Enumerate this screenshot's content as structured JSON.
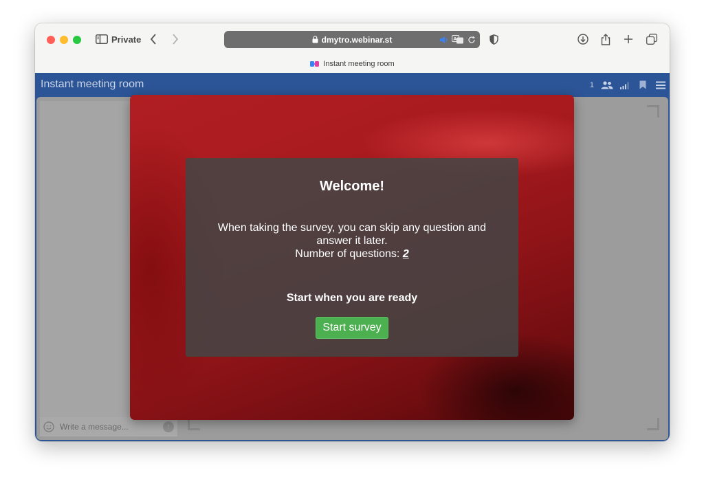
{
  "browser": {
    "private_label": "Private",
    "url": "dmytro.webinar.st",
    "tab_title": "Instant meeting room"
  },
  "room": {
    "title": "Instant meeting room",
    "participant_count": "1"
  },
  "chat": {
    "placeholder": "Write a message..."
  },
  "survey": {
    "welcome": "Welcome!",
    "description": "When taking the survey, you can skip any question and answer it later.",
    "questions_label": "Number of questions:",
    "questions_count": "2",
    "ready_text": "Start when you are ready",
    "start_button": "Start survey"
  },
  "colors": {
    "header_blue": "#2c5597",
    "start_green": "#4caf50",
    "modal_red": "#a81a1e"
  }
}
